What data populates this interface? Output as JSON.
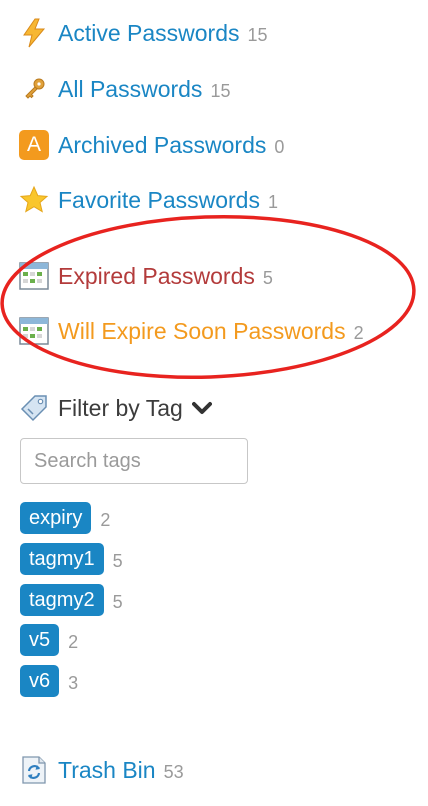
{
  "nav": {
    "active": {
      "label": "Active Passwords",
      "count": "15",
      "icon": "lightning-icon"
    },
    "all": {
      "label": "All Passwords",
      "count": "15",
      "icon": "key-icon"
    },
    "archived": {
      "label": "Archived Passwords",
      "count": "0",
      "icon": "archive-a-icon",
      "icon_letter": "A"
    },
    "favorite": {
      "label": "Favorite Passwords",
      "count": "1",
      "icon": "star-icon"
    },
    "expired": {
      "label": "Expired Passwords",
      "count": "5",
      "icon": "calendar-icon"
    },
    "expire_soon": {
      "label": "Will Expire Soon Passwords",
      "count": "2",
      "icon": "calendar-icon"
    },
    "trash": {
      "label": "Trash Bin",
      "count": "53",
      "icon": "recycle-icon"
    }
  },
  "filter": {
    "label": "Filter by Tag",
    "icon": "tag-icon",
    "toggle_icon": "chevron-down-icon",
    "search_placeholder": "Search tags",
    "search_value": ""
  },
  "tags": [
    {
      "name": "expiry",
      "count": "2"
    },
    {
      "name": "tagmy1",
      "count": "5"
    },
    {
      "name": "tagmy2",
      "count": "5"
    },
    {
      "name": "v5",
      "count": "2"
    },
    {
      "name": "v6",
      "count": "3"
    }
  ],
  "colors": {
    "link": "#1a86c4",
    "expired": "#b33b3b",
    "expire_soon": "#f39a1e",
    "count": "#9a9a9a",
    "annotation_ring": "#e8231f"
  }
}
